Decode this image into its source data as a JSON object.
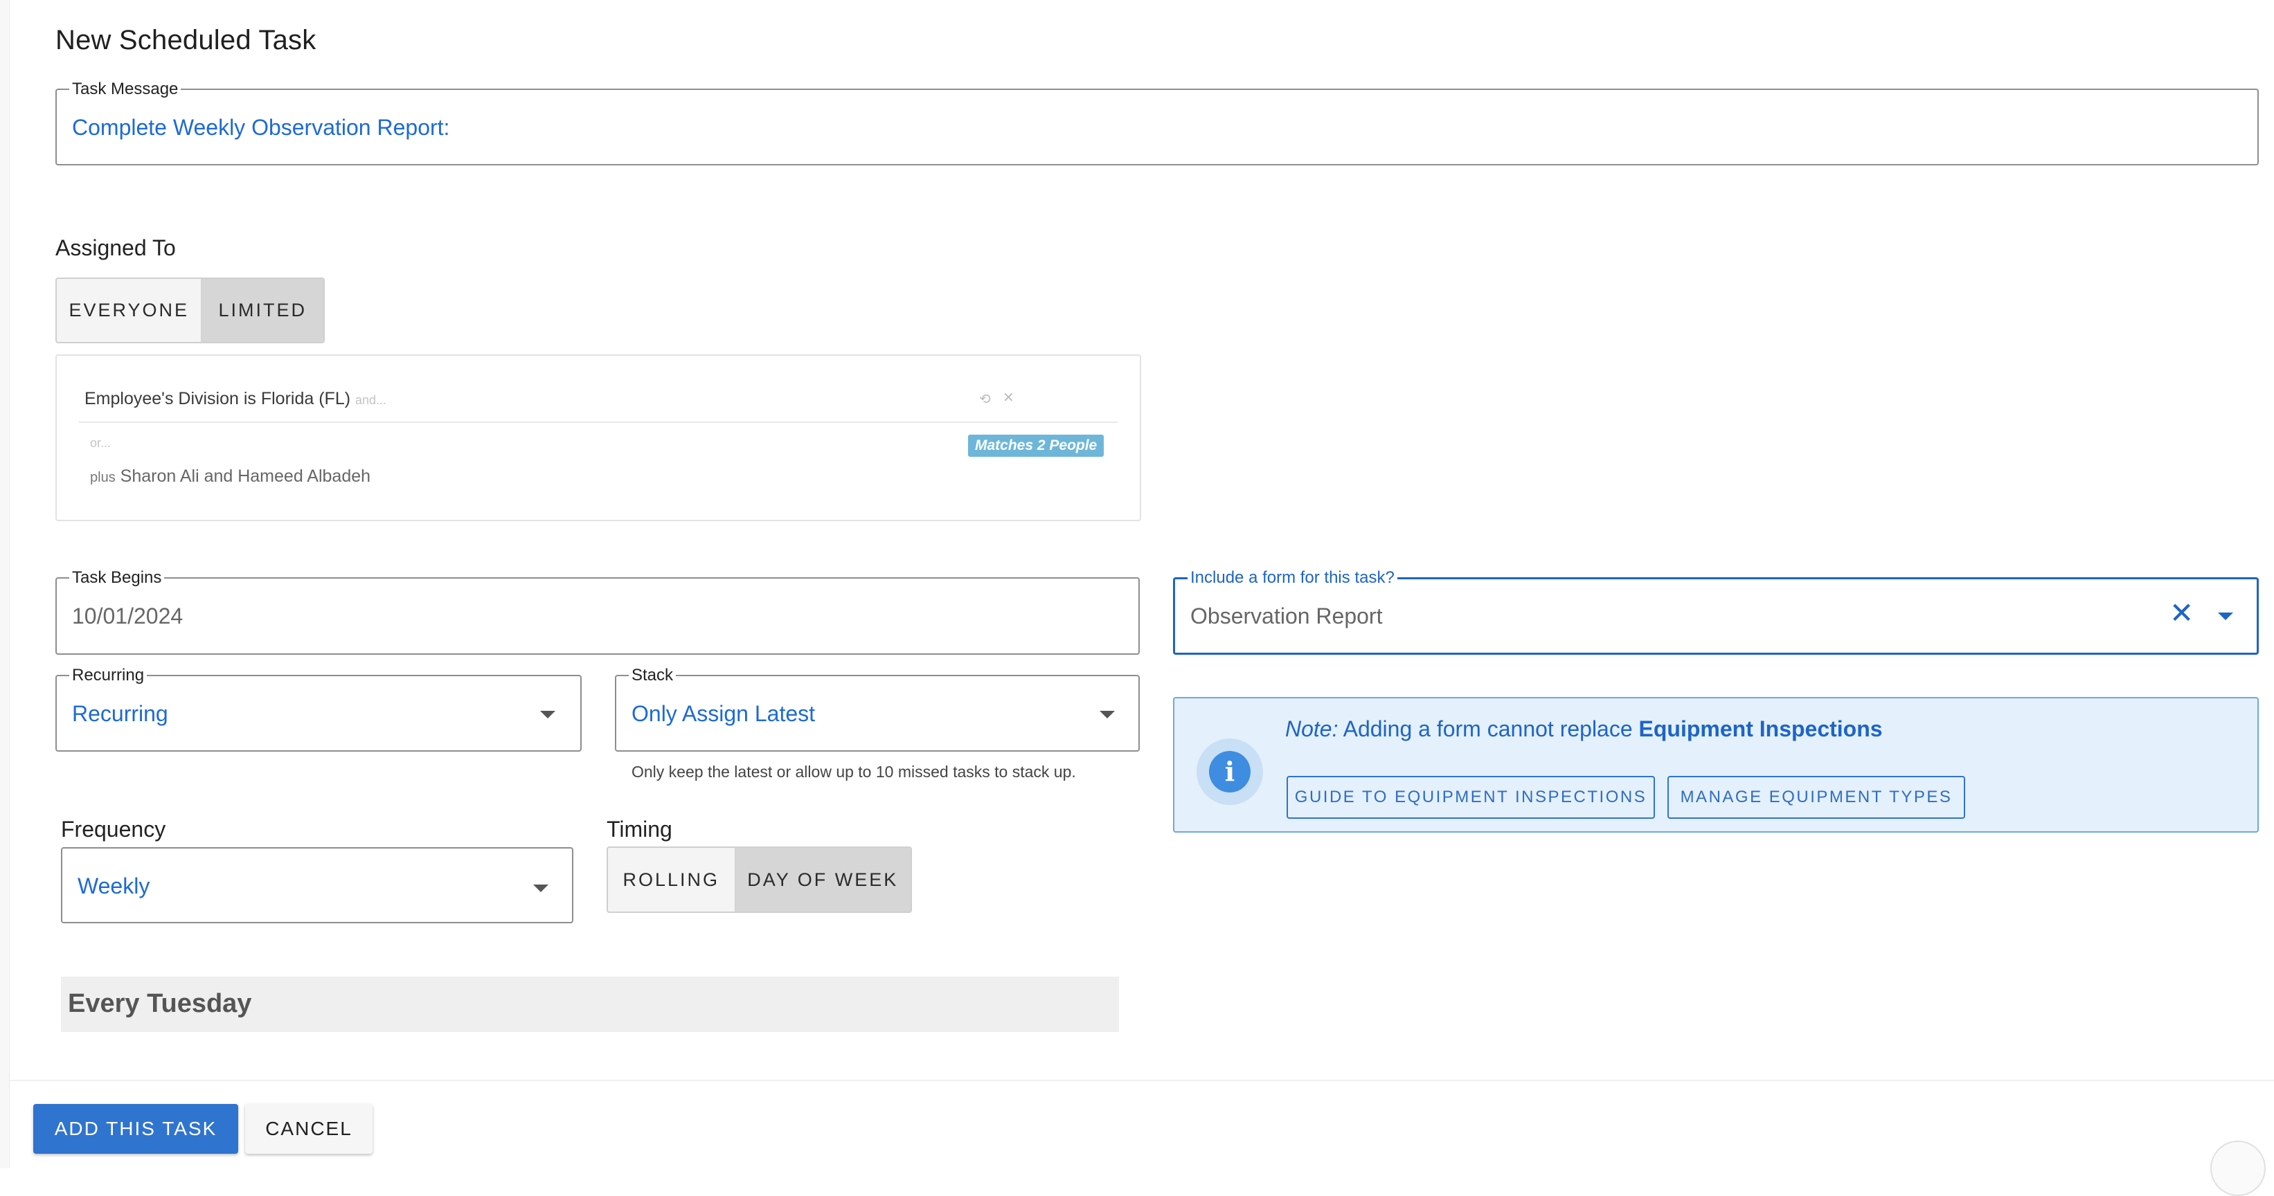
{
  "dialog": {
    "title": "New Scheduled Task"
  },
  "task_message": {
    "label": "Task Message",
    "value": "Complete Weekly Observation Report:"
  },
  "assigned_to": {
    "label": "Assigned To",
    "options": [
      "EVERYONE",
      "LIMITED"
    ],
    "selected": "LIMITED",
    "rule": "Employee's Division is Florida (FL)",
    "and_hint": "and...",
    "or_hint": "or...",
    "matches_badge": "Matches 2 People",
    "plus_prefix": "plus",
    "plus_people": "Sharon Ali and Hameed Albadeh",
    "rule_icons": [
      "repeat-icon",
      "close-icon"
    ]
  },
  "task_begins": {
    "label": "Task Begins",
    "value": "10/01/2024"
  },
  "form": {
    "label": "Include a form for this task?",
    "value": "Observation Report"
  },
  "note": {
    "prefix": "Note:",
    "text": "Adding a form cannot replace",
    "bold": "Equipment Inspections",
    "buttons": [
      "GUIDE TO EQUIPMENT INSPECTIONS",
      "MANAGE EQUIPMENT TYPES"
    ]
  },
  "recurring": {
    "label": "Recurring",
    "value": "Recurring"
  },
  "stack": {
    "label": "Stack",
    "value": "Only Assign Latest",
    "helper": "Only keep the latest or allow up to 10 missed tasks to stack up."
  },
  "frequency": {
    "label": "Frequency",
    "value": "Weekly"
  },
  "timing": {
    "label": "Timing",
    "options": [
      "ROLLING",
      "DAY OF WEEK"
    ],
    "selected": "DAY OF WEEK"
  },
  "schedule_summary": "Every Tuesday",
  "footer": {
    "add_label": "ADD THIS TASK",
    "cancel_label": "CANCEL"
  },
  "colors": {
    "accent": "#2f74cf",
    "link_text": "#1d6ad6",
    "note_bg": "#e4f0fb",
    "badge": "#6eb6d9"
  }
}
